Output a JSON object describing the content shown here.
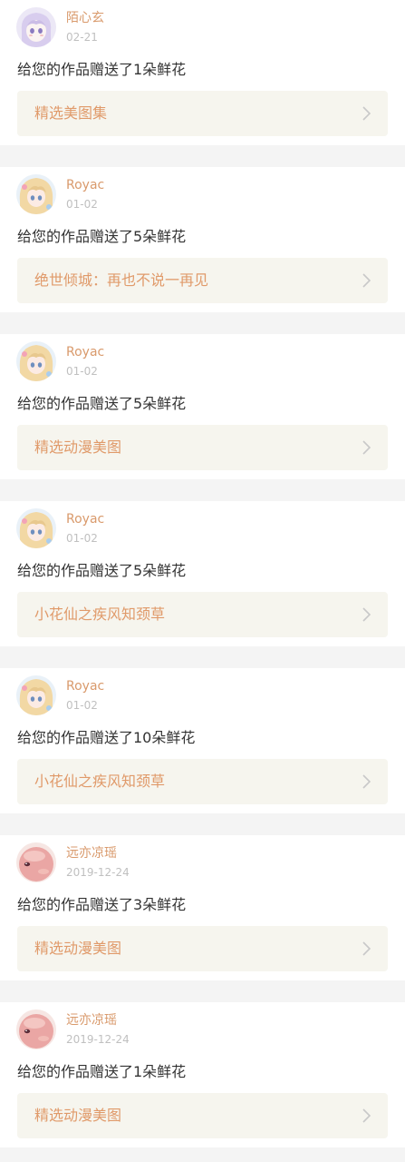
{
  "notifications": [
    {
      "username": "陌心玄",
      "date": "02-21",
      "message": "给您的作品赠送了1朵鲜花",
      "work_title": "精选美图集",
      "avatar": "anime-girl-lavender-avatar"
    },
    {
      "username": "Royac",
      "date": "01-02",
      "message": "给您的作品赠送了5朵鲜花",
      "work_title": "绝世倾城：再也不说一再见",
      "avatar": "anime-girl-blonde-avatar"
    },
    {
      "username": "Royac",
      "date": "01-02",
      "message": "给您的作品赠送了5朵鲜花",
      "work_title": "精选动漫美图",
      "avatar": "anime-girl-blonde-avatar"
    },
    {
      "username": "Royac",
      "date": "01-02",
      "message": "给您的作品赠送了5朵鲜花",
      "work_title": "小花仙之疾风知颈草",
      "avatar": "anime-girl-blonde-avatar"
    },
    {
      "username": "Royac",
      "date": "01-02",
      "message": "给您的作品赠送了10朵鲜花",
      "work_title": "小花仙之疾风知颈草",
      "avatar": "anime-girl-blonde-avatar"
    },
    {
      "username": "远亦凉瑶",
      "date": "2019-12-24",
      "message": "给您的作品赠送了3朵鲜花",
      "work_title": "精选动漫美图",
      "avatar": "pink-cartoon-avatar"
    },
    {
      "username": "远亦凉瑶",
      "date": "2019-12-24",
      "message": "给您的作品赠送了1朵鲜花",
      "work_title": "精选动漫美图",
      "avatar": "pink-cartoon-avatar"
    }
  ],
  "colors": {
    "username": "#d99a6c",
    "work_title": "#e09a6a",
    "link_background": "#f6f5ee",
    "date": "#c0c0c0",
    "message": "#333333",
    "page_background": "#f4f4f4"
  },
  "icons": {
    "chevron": "chevron-right-icon"
  }
}
